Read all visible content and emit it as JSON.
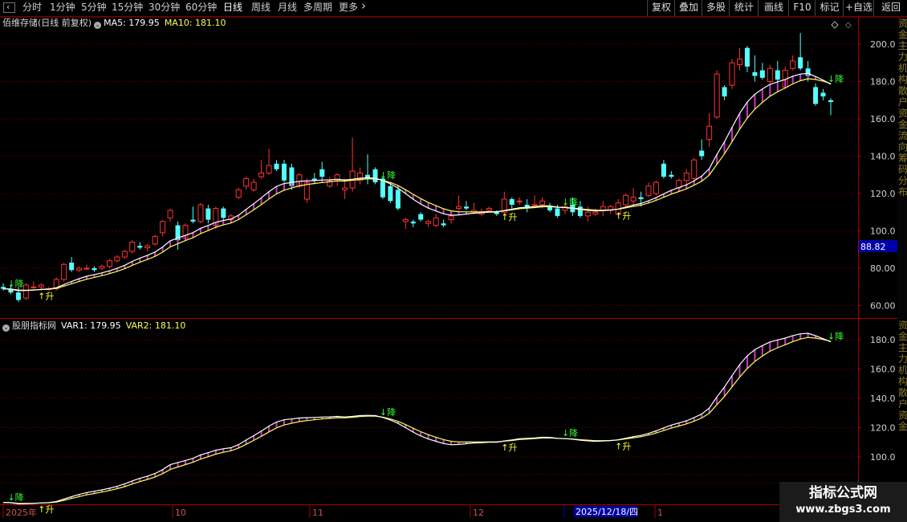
{
  "toolbar": {
    "left_items": [
      "分时",
      "1分钟",
      "5分钟",
      "15分钟",
      "30分钟",
      "60分钟",
      "日线",
      "周线",
      "月线",
      "多周期",
      "更多"
    ],
    "active": "日线",
    "right_items": [
      "复权",
      "叠加",
      "多股",
      "统计",
      "画线",
      "F10",
      "标记",
      "+自选",
      "返回"
    ]
  },
  "main_header": {
    "stock_name": "佰维存储(日线 前复权)",
    "ma5_label": "MA5: 179.95",
    "ma10_label": "MA10: 181.10",
    "ma5_color": "#ffffff",
    "ma10_color": "#ffff55"
  },
  "sub_header": {
    "indicator_name": "股朋指标网",
    "var1_label": "VAR1: 179.95",
    "var2_label": "VAR2: 181.10"
  },
  "main_axis": {
    "ticks": [
      "200.0",
      "180.0",
      "160.0",
      "140.0",
      "120.0",
      "100.0",
      "80.00",
      "60.00"
    ],
    "current_price": "88.82"
  },
  "sub_axis": {
    "ticks": [
      "180.0",
      "160.0",
      "140.0",
      "120.0",
      "100.0"
    ]
  },
  "time_axis": {
    "labels": [
      "2025年",
      "10",
      "11",
      "12",
      "1"
    ],
    "highlight_date": "2025/12/18/四"
  },
  "markers": {
    "up": "↑升",
    "down": "↓降"
  },
  "side_strip_text": "资金主力机构散户资金流向筹码分布",
  "watermark": {
    "title": "指标公式网",
    "url": "www.zbgs3.com"
  },
  "colors": {
    "up": "#ff3232",
    "down": "#54ffff",
    "band": "#cc33cc",
    "grid": "#7a0000",
    "border": "#aa0000"
  },
  "chart_data": {
    "type": "candlestick",
    "candles": [
      {
        "o": 70,
        "h": 72,
        "l": 68,
        "c": 69
      },
      {
        "o": 69,
        "h": 71,
        "l": 66,
        "c": 67
      },
      {
        "o": 67,
        "h": 70,
        "l": 62,
        "c": 63
      },
      {
        "o": 64,
        "h": 72,
        "l": 63,
        "c": 71
      },
      {
        "o": 70,
        "h": 73,
        "l": 69,
        "c": 70
      },
      {
        "o": 70,
        "h": 72,
        "l": 68,
        "c": 71
      },
      {
        "o": 69,
        "h": 70,
        "l": 68,
        "c": 69
      },
      {
        "o": 69,
        "h": 75,
        "l": 68,
        "c": 74
      },
      {
        "o": 74,
        "h": 83,
        "l": 73,
        "c": 82
      },
      {
        "o": 83,
        "h": 86,
        "l": 78,
        "c": 79
      },
      {
        "o": 79,
        "h": 81,
        "l": 78,
        "c": 80
      },
      {
        "o": 80,
        "h": 82,
        "l": 79,
        "c": 80
      },
      {
        "o": 80,
        "h": 81,
        "l": 78,
        "c": 79
      },
      {
        "o": 80,
        "h": 82,
        "l": 79,
        "c": 81
      },
      {
        "o": 81,
        "h": 85,
        "l": 80,
        "c": 84
      },
      {
        "o": 84,
        "h": 87,
        "l": 83,
        "c": 86
      },
      {
        "o": 86,
        "h": 90,
        "l": 85,
        "c": 89
      },
      {
        "o": 89,
        "h": 95,
        "l": 88,
        "c": 94
      },
      {
        "o": 92,
        "h": 94,
        "l": 90,
        "c": 91
      },
      {
        "o": 91,
        "h": 93,
        "l": 89,
        "c": 92
      },
      {
        "o": 93,
        "h": 98,
        "l": 92,
        "c": 97
      },
      {
        "o": 99,
        "h": 106,
        "l": 97,
        "c": 105
      },
      {
        "o": 107,
        "h": 112,
        "l": 105,
        "c": 111
      },
      {
        "o": 103,
        "h": 105,
        "l": 90,
        "c": 95
      },
      {
        "o": 96,
        "h": 104,
        "l": 95,
        "c": 103
      },
      {
        "o": 106,
        "h": 113,
        "l": 104,
        "c": 105
      },
      {
        "o": 105,
        "h": 115,
        "l": 104,
        "c": 114
      },
      {
        "o": 112,
        "h": 114,
        "l": 104,
        "c": 106
      },
      {
        "o": 103,
        "h": 113,
        "l": 101,
        "c": 112
      },
      {
        "o": 112,
        "h": 113,
        "l": 105,
        "c": 107
      },
      {
        "o": 106,
        "h": 109,
        "l": 104,
        "c": 108
      },
      {
        "o": 118,
        "h": 123,
        "l": 117,
        "c": 122
      },
      {
        "o": 124,
        "h": 129,
        "l": 122,
        "c": 128
      },
      {
        "o": 122,
        "h": 128,
        "l": 121,
        "c": 126
      },
      {
        "o": 129,
        "h": 138,
        "l": 128,
        "c": 131
      },
      {
        "o": 131,
        "h": 144,
        "l": 130,
        "c": 135
      },
      {
        "o": 136,
        "h": 138,
        "l": 132,
        "c": 133
      },
      {
        "o": 136,
        "h": 138,
        "l": 126,
        "c": 127
      },
      {
        "o": 134,
        "h": 136,
        "l": 122,
        "c": 124
      },
      {
        "o": 124,
        "h": 131,
        "l": 123,
        "c": 130
      },
      {
        "o": 117,
        "h": 128,
        "l": 115,
        "c": 126
      },
      {
        "o": 128,
        "h": 131,
        "l": 125,
        "c": 127
      },
      {
        "o": 133,
        "h": 137,
        "l": 127,
        "c": 129
      },
      {
        "o": 124,
        "h": 129,
        "l": 123,
        "c": 127
      },
      {
        "o": 127,
        "h": 131,
        "l": 124,
        "c": 130
      },
      {
        "o": 122,
        "h": 128,
        "l": 117,
        "c": 123
      },
      {
        "o": 123,
        "h": 150,
        "l": 121,
        "c": 132
      },
      {
        "o": 127,
        "h": 134,
        "l": 125,
        "c": 131
      },
      {
        "o": 130,
        "h": 141,
        "l": 125,
        "c": 128
      },
      {
        "o": 133,
        "h": 134,
        "l": 125,
        "c": 126
      },
      {
        "o": 128,
        "h": 129,
        "l": 117,
        "c": 118
      },
      {
        "o": 124,
        "h": 126,
        "l": 115,
        "c": 116
      },
      {
        "o": 122,
        "h": 123,
        "l": 111,
        "c": 112
      },
      {
        "o": 105,
        "h": 107,
        "l": 101,
        "c": 106
      },
      {
        "o": 105,
        "h": 106,
        "l": 102,
        "c": 104
      },
      {
        "o": 109,
        "h": 110,
        "l": 105,
        "c": 106
      },
      {
        "o": 104,
        "h": 106,
        "l": 102,
        "c": 105
      },
      {
        "o": 103,
        "h": 109,
        "l": 102,
        "c": 107
      },
      {
        "o": 104,
        "h": 106,
        "l": 102,
        "c": 103
      },
      {
        "o": 106,
        "h": 110,
        "l": 104,
        "c": 108
      },
      {
        "o": 112,
        "h": 119,
        "l": 111,
        "c": 113
      },
      {
        "o": 113,
        "h": 116,
        "l": 111,
        "c": 112
      },
      {
        "o": 110,
        "h": 115,
        "l": 109,
        "c": 111
      },
      {
        "o": 109,
        "h": 112,
        "l": 108,
        "c": 110
      },
      {
        "o": 111,
        "h": 113,
        "l": 110,
        "c": 112
      },
      {
        "o": 110,
        "h": 111,
        "l": 108,
        "c": 109
      },
      {
        "o": 110,
        "h": 121,
        "l": 109,
        "c": 117
      },
      {
        "o": 117,
        "h": 118,
        "l": 112,
        "c": 114
      },
      {
        "o": 116,
        "h": 118,
        "l": 114,
        "c": 116
      },
      {
        "o": 114,
        "h": 117,
        "l": 110,
        "c": 112
      },
      {
        "o": 114,
        "h": 119,
        "l": 113,
        "c": 114
      },
      {
        "o": 114,
        "h": 118,
        "l": 112,
        "c": 116
      },
      {
        "o": 113,
        "h": 115,
        "l": 110,
        "c": 111
      },
      {
        "o": 112,
        "h": 114,
        "l": 107,
        "c": 108
      },
      {
        "o": 111,
        "h": 114,
        "l": 109,
        "c": 113
      },
      {
        "o": 114,
        "h": 118,
        "l": 108,
        "c": 110
      },
      {
        "o": 113,
        "h": 116,
        "l": 107,
        "c": 108
      },
      {
        "o": 108,
        "h": 113,
        "l": 105,
        "c": 110
      },
      {
        "o": 109,
        "h": 112,
        "l": 108,
        "c": 110
      },
      {
        "o": 111,
        "h": 116,
        "l": 108,
        "c": 113
      },
      {
        "o": 111,
        "h": 114,
        "l": 109,
        "c": 113
      },
      {
        "o": 109,
        "h": 117,
        "l": 108,
        "c": 115
      },
      {
        "o": 114,
        "h": 120,
        "l": 112,
        "c": 119
      },
      {
        "o": 116,
        "h": 123,
        "l": 114,
        "c": 118
      },
      {
        "o": 118,
        "h": 121,
        "l": 113,
        "c": 117
      },
      {
        "o": 119,
        "h": 126,
        "l": 118,
        "c": 124
      },
      {
        "o": 120,
        "h": 127,
        "l": 119,
        "c": 126
      },
      {
        "o": 136,
        "h": 138,
        "l": 128,
        "c": 129
      },
      {
        "o": 130,
        "h": 132,
        "l": 128,
        "c": 129
      },
      {
        "o": 123,
        "h": 128,
        "l": 121,
        "c": 127
      },
      {
        "o": 127,
        "h": 133,
        "l": 125,
        "c": 131
      },
      {
        "o": 128,
        "h": 139,
        "l": 127,
        "c": 138
      },
      {
        "o": 143,
        "h": 149,
        "l": 138,
        "c": 140
      },
      {
        "o": 149,
        "h": 163,
        "l": 145,
        "c": 156
      },
      {
        "o": 161,
        "h": 186,
        "l": 160,
        "c": 184
      },
      {
        "o": 177,
        "h": 178,
        "l": 170,
        "c": 172
      },
      {
        "o": 178,
        "h": 192,
        "l": 176,
        "c": 190
      },
      {
        "o": 189,
        "h": 198,
        "l": 186,
        "c": 192
      },
      {
        "o": 198,
        "h": 199,
        "l": 185,
        "c": 188
      },
      {
        "o": 185,
        "h": 194,
        "l": 180,
        "c": 183
      },
      {
        "o": 186,
        "h": 190,
        "l": 181,
        "c": 182
      },
      {
        "o": 180,
        "h": 189,
        "l": 179,
        "c": 187
      },
      {
        "o": 186,
        "h": 191,
        "l": 180,
        "c": 181
      },
      {
        "o": 177,
        "h": 188,
        "l": 176,
        "c": 186
      },
      {
        "o": 187,
        "h": 194,
        "l": 186,
        "c": 191
      },
      {
        "o": 193,
        "h": 206,
        "l": 186,
        "c": 187
      },
      {
        "o": 187,
        "h": 191,
        "l": 180,
        "c": 183
      },
      {
        "o": 177,
        "h": 179,
        "l": 167,
        "c": 168
      },
      {
        "o": 174,
        "h": 176,
        "l": 170,
        "c": 172
      },
      {
        "o": 170,
        "h": 171,
        "l": 162,
        "c": 169
      }
    ]
  }
}
